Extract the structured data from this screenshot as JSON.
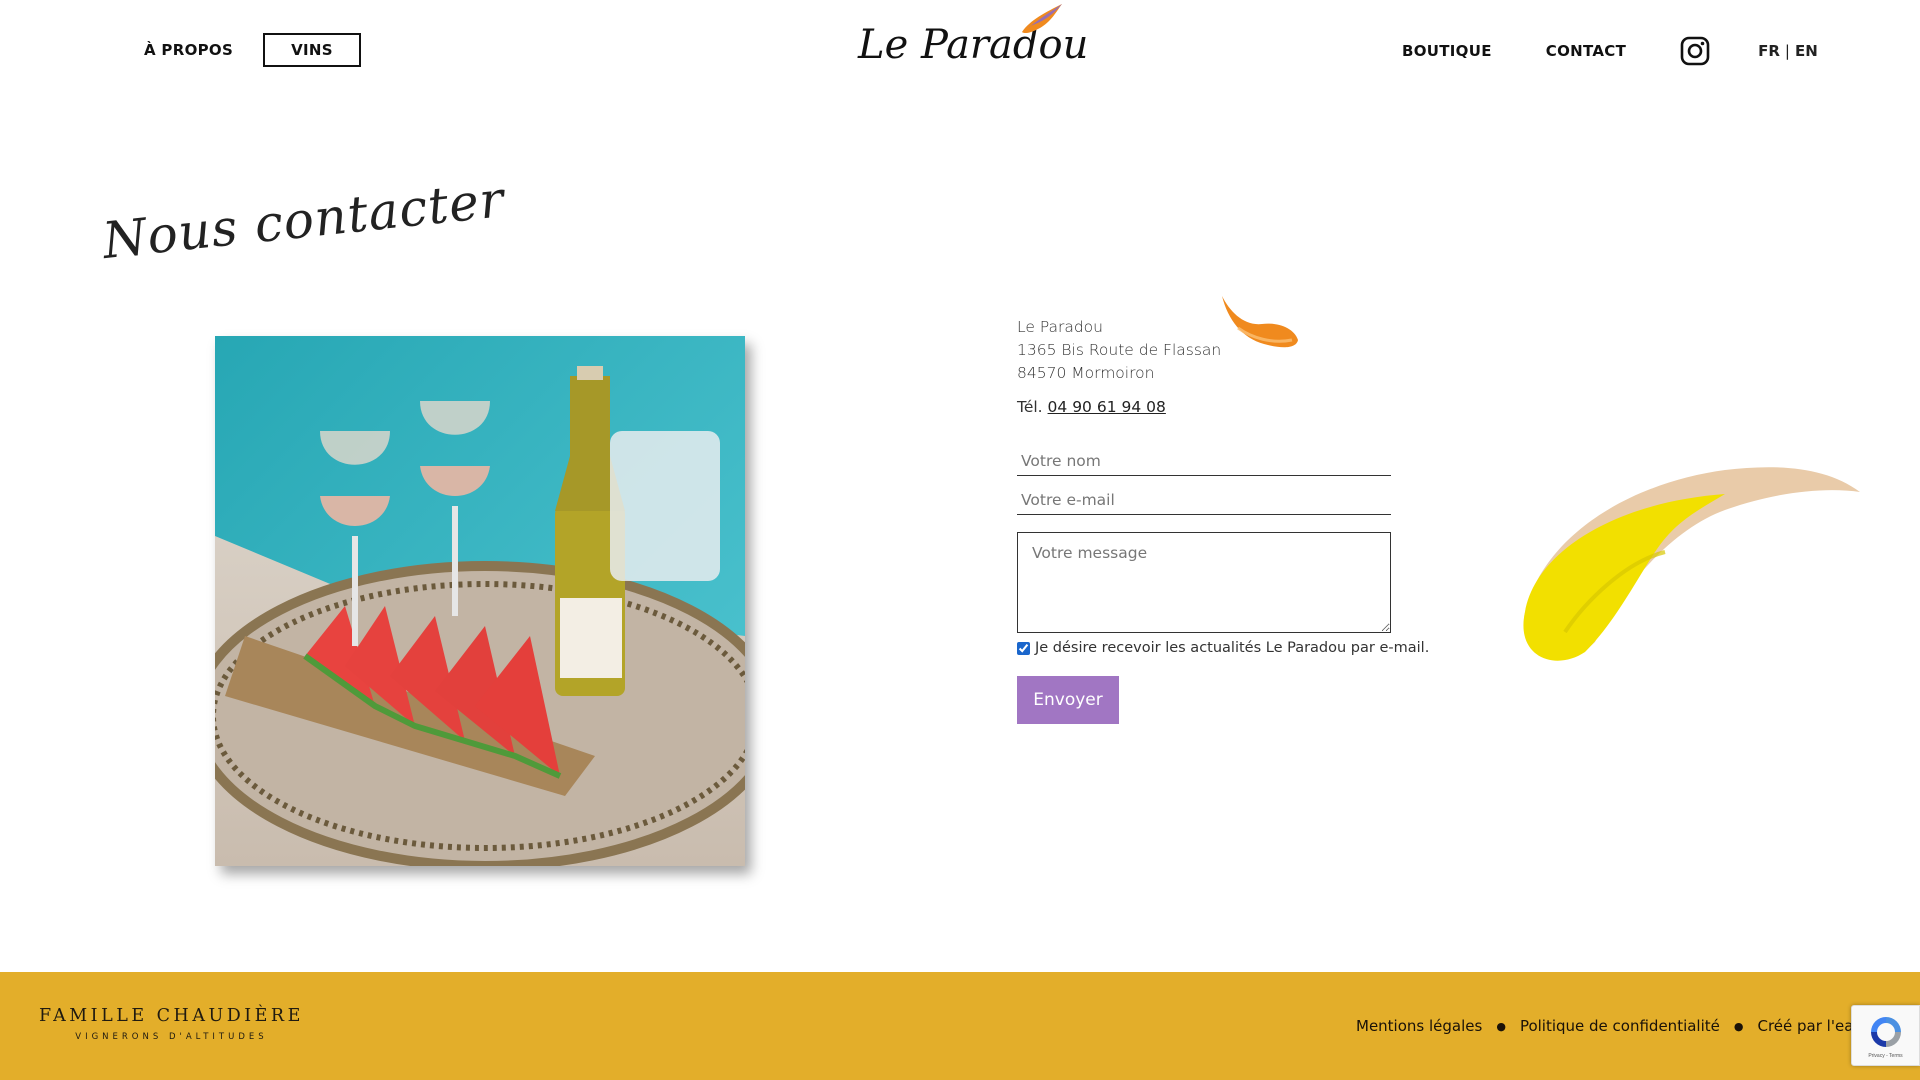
{
  "header": {
    "nav_left": [
      "À PROPOS",
      "VINS"
    ],
    "logo_text": "Le Paradou",
    "nav_right": [
      "BOUTIQUE",
      "CONTACT"
    ],
    "lang": {
      "fr": "FR",
      "sep": "|",
      "en": "EN"
    }
  },
  "page_title": "Nous contacter",
  "address": {
    "name": "Le Paradou",
    "street": "1365 Bis Route de Flassan",
    "city": "84570 Mormoiron",
    "tel_label": "Tél.",
    "tel": "04 90 61 94 08"
  },
  "form": {
    "name_placeholder": "Votre nom",
    "email_placeholder": "Votre e-mail",
    "message_placeholder": "Votre message",
    "consent": "Je désire recevoir les actualités Le Paradou par e-mail.",
    "submit": "Envoyer"
  },
  "footer": {
    "family": "FAMILLE CHAUDIÈRE",
    "tagline": "VIGNERONS D'ALTITUDES",
    "links": [
      "Mentions légales",
      "Politique de confidentialité",
      "Créé par l'eau à la bouche"
    ],
    "recaptcha_terms": "Privacy - Terms"
  },
  "colors": {
    "footer_bg": "#e3ae2a",
    "button_bg": "#a176c3",
    "brush_orange": "#f08a1e",
    "brush_yellow": "#f2e000"
  },
  "icons": [
    "instagram-icon",
    "brush-stroke-orange",
    "brush-stroke-yellow",
    "recaptcha-icon"
  ]
}
